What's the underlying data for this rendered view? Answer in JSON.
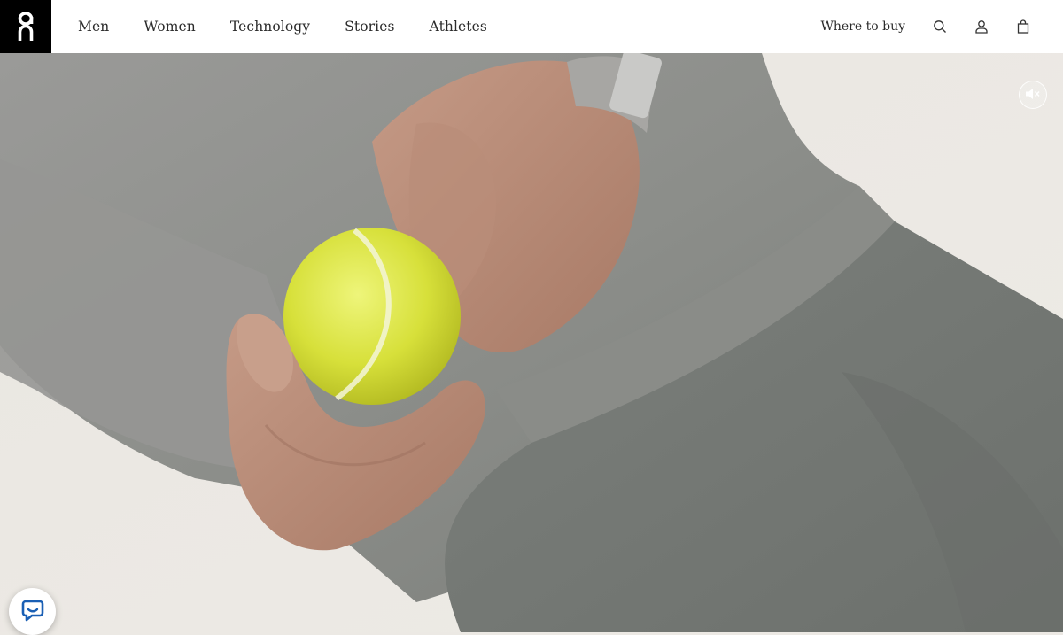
{
  "brand": {
    "logo_icon": "on-logo",
    "colors": {
      "header_bg": "#ffffff",
      "logo_bg": "#000000",
      "chat_accent": "#1a5fb4"
    }
  },
  "nav": {
    "items": [
      {
        "label": "Men"
      },
      {
        "label": "Women"
      },
      {
        "label": "Technology"
      },
      {
        "label": "Stories"
      },
      {
        "label": "Athletes"
      }
    ]
  },
  "header_right": {
    "where_to_buy": "Where to buy",
    "icons": [
      "search-icon",
      "account-icon",
      "bag-icon"
    ]
  },
  "hero": {
    "media": "video",
    "mute_icon": "speaker-muted-icon",
    "subject": "hand-holding-tennis-ball"
  },
  "chat": {
    "icon": "chat-bubble-icon"
  }
}
